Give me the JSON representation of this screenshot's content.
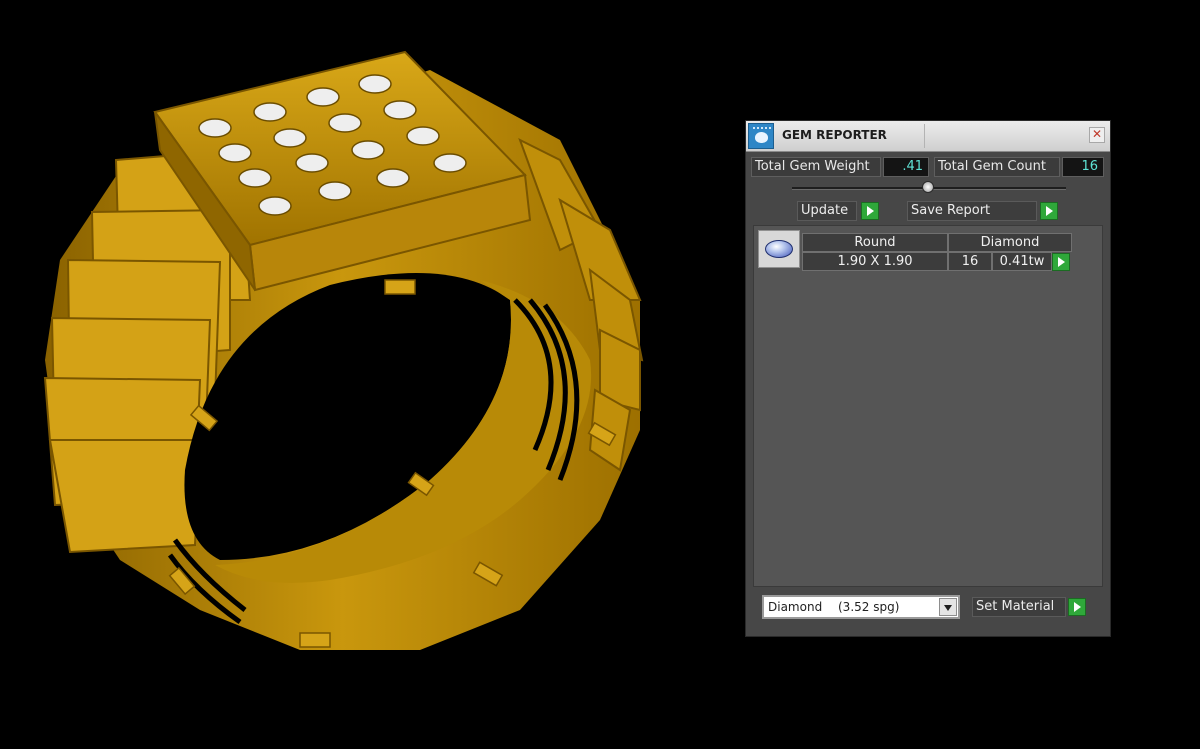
{
  "panel": {
    "title": "GEM REPORTER",
    "close_glyph": "✕",
    "total_gem_weight_label": "Total Gem Weight",
    "total_gem_weight_value": ".41",
    "total_gem_count_label": "Total Gem Count",
    "total_gem_count_value": "16",
    "update_label": "Update",
    "save_report_label": "Save Report",
    "gem_row": {
      "shape": "Round",
      "material": "Diamond",
      "size": "1.90 X 1.90",
      "count": "16",
      "weight": "0.41tw"
    },
    "material_select": {
      "value": "Diamond",
      "spg": "(3.52 spg)"
    },
    "set_material_label": "Set Material"
  },
  "icons": {
    "app": "gem-reporter-app-icon",
    "close": "close-icon",
    "go": "play-arrow-icon",
    "dropdown": "chevron-down-icon",
    "gem_thumbnail": "round-diamond-icon"
  },
  "colors": {
    "ring_gold": "#c9970d",
    "panel_bg": "#474747",
    "value_text": "#5fe3d6",
    "go_button": "#2fa83a"
  }
}
